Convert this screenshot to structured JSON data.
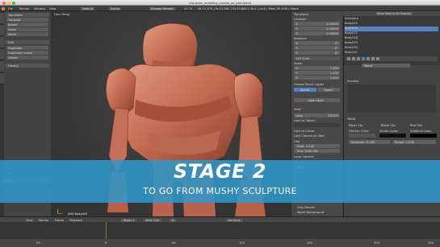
{
  "window": {
    "title": "character_modeling_tutorial_ex_plan.blend"
  },
  "infobar": {
    "menus": [
      "File",
      "Render",
      "Window",
      "Help"
    ],
    "screen": "Default",
    "scene": "Scene",
    "engine": "Blender Render",
    "stats": "Ve:11,970 | Fa:11,960 | Tri:23,680 | Ob:1 | La:0 | Mem:59.41M | Robot",
    "version": "v2.74"
  },
  "left_panel": {
    "section_transform": "Transform",
    "buttons": [
      "Translate",
      "Rotate",
      "Scale",
      "Mirror"
    ],
    "section_edit": "Edit",
    "edit_buttons": [
      "Duplicate",
      "Duplicate Linked",
      "Delete"
    ],
    "section_history": "History",
    "operator_header": "Mirror",
    "operator_field": "Shape"
  },
  "viewport": {
    "label": "User Persp",
    "object_name": "(60) Body025"
  },
  "n_panel": {
    "section_transform": "Transform",
    "location_label": "Location:",
    "loc": [
      "X:",
      "0.00000",
      "Y:",
      "0.00000",
      "Z:",
      "0.00000"
    ],
    "rotation_label": "Rotation:",
    "rot": [
      "X:",
      "0°",
      "Y:",
      "0°",
      "Z:",
      "0°"
    ],
    "mode": "XYZ Euler",
    "scale_label": "Scale:",
    "scale": [
      "X:",
      "1.000",
      "Y:",
      "1.000",
      "Z:",
      "1.000"
    ],
    "section_grease": "Grease Pencil Layers",
    "grease_tabs": [
      "Scene",
      "Object"
    ],
    "new_layer": "New Layer",
    "section_view": "View",
    "lens_label": "Lens:",
    "lens_value": "35.000",
    "lock_label": "Lock to Object:",
    "lock_cursor": "Lock to Cursor",
    "lock_camera": "Lock Camera to View",
    "clip_label": "Clip:",
    "clip_start": "Start: 0.100",
    "clip_end": "End: 1000.000",
    "local_camera": "Local Camera",
    "section_display": "Display",
    "only_render": "Only Render",
    "world_bg": "World Background"
  },
  "outliner": {
    "header": "View Search All Scenes",
    "items": [
      "Armature",
      "Body025",
      "Body026",
      "Body027",
      "Body028",
      "Body029",
      "Body030",
      "Body031"
    ]
  },
  "properties": {
    "section_preview": "Preview",
    "section_world": "World",
    "world_name": "World",
    "paper_sky": "Paper Sky",
    "blend_sky": "Blend Sky",
    "real_sky": "Real Sky",
    "horizon": "Horizon Color:",
    "zenith": "Zenith Color:",
    "ambient": "Ambient Color:",
    "exposure": "Exposure: 0.000",
    "range": "Range: 1.000"
  },
  "timeline": {
    "menus": [
      "View",
      "Marker",
      "Frame",
      "Playback"
    ],
    "start": "Start: 1",
    "end": "End: 250",
    "current": "0",
    "sync": "No Sync",
    "ticks": [
      "-50",
      "0",
      "50",
      "100",
      "150",
      "200",
      "250"
    ]
  },
  "overlay": {
    "title": "STAGE 2",
    "subtitle": "TO GO FROM MUSHY SCULPTURE"
  },
  "colors": {
    "banner": "#3096c8",
    "sculpt": "#c8735a",
    "selection": "#5680c2"
  }
}
